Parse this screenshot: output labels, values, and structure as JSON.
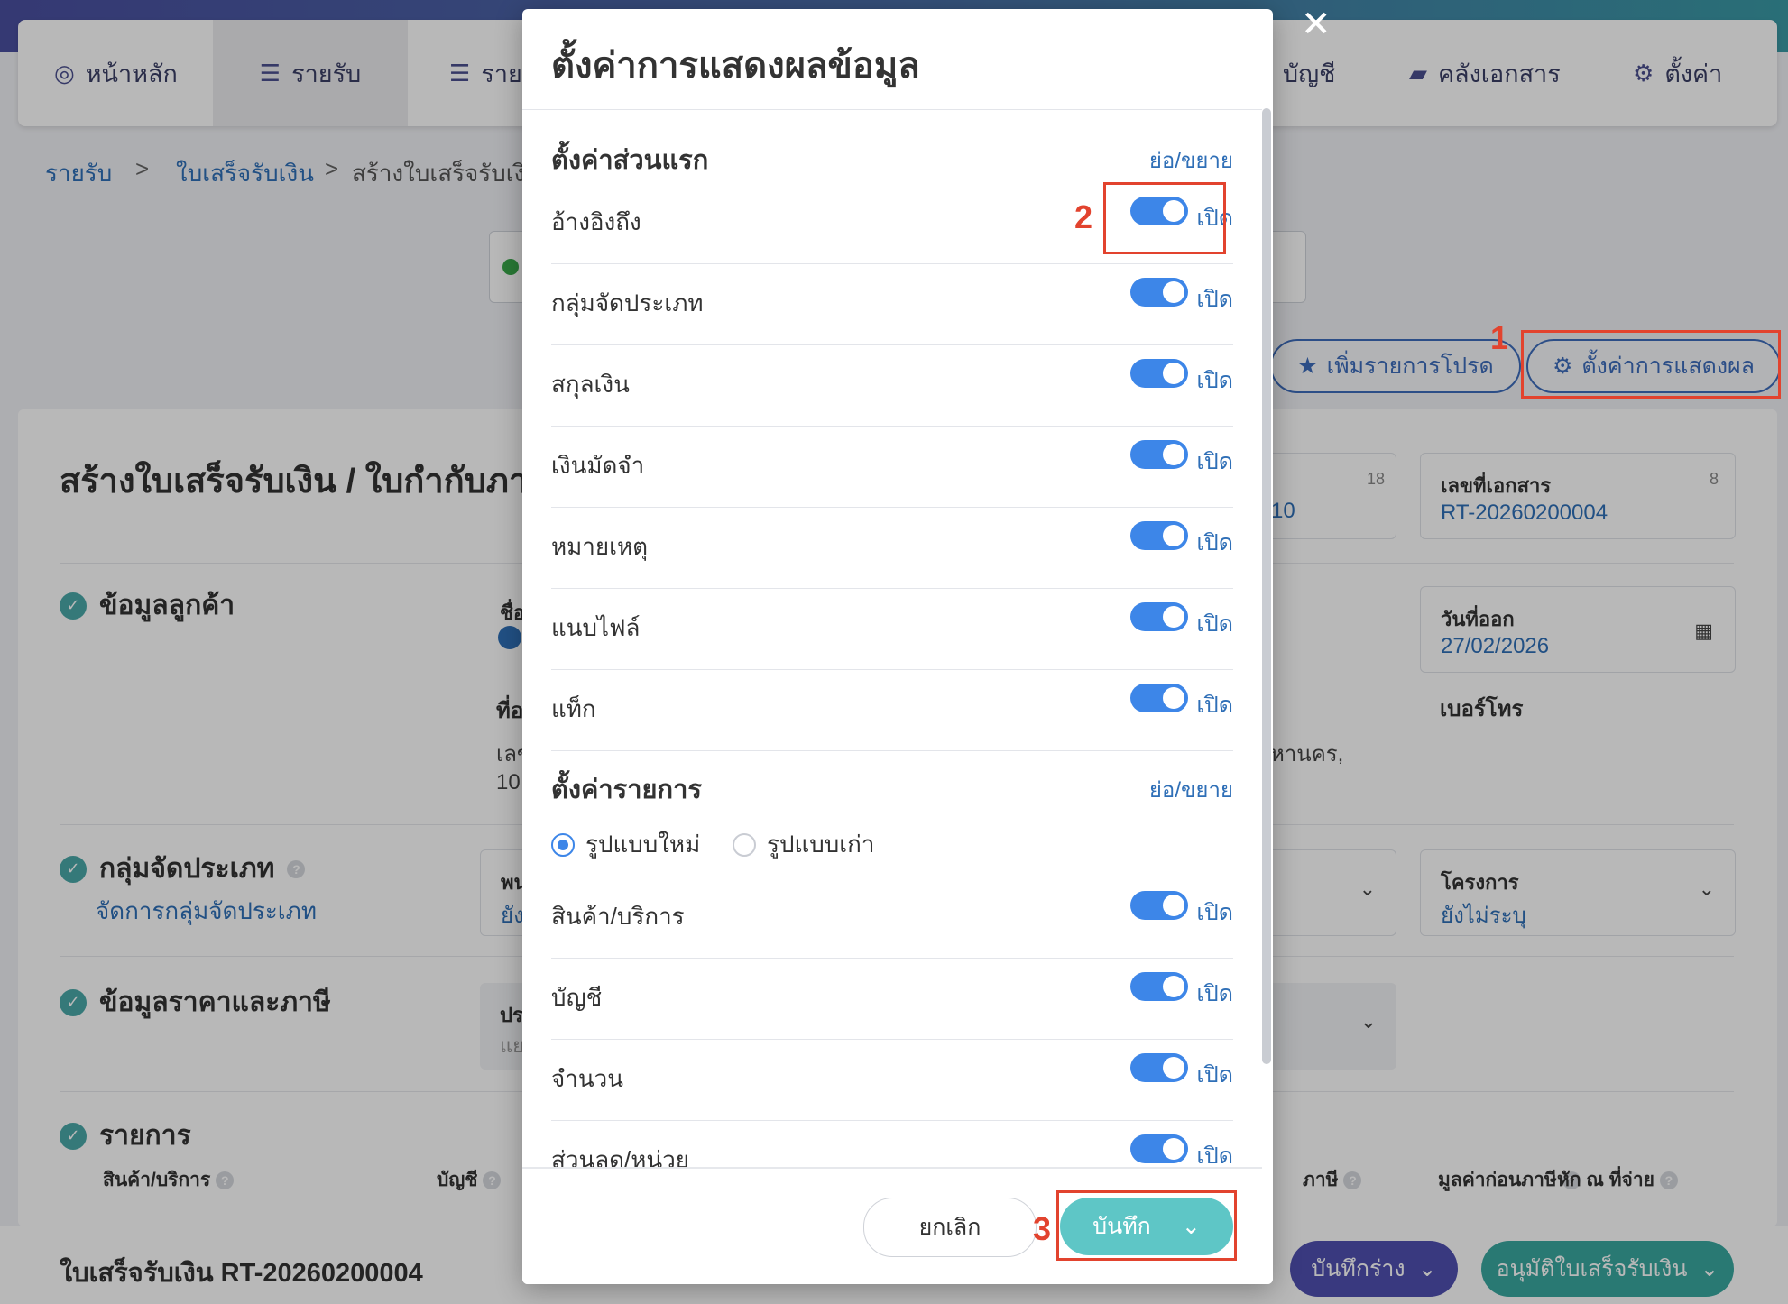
{
  "nav": {
    "items": [
      {
        "label": "หน้าหลัก",
        "icon": "dashboard-icon"
      },
      {
        "label": "รายรับ",
        "icon": "income-list-icon"
      },
      {
        "label": "ราย",
        "icon": "expense-list-icon"
      },
      {
        "label": "บัญชี",
        "icon": "accounting-icon"
      },
      {
        "label": "คลังเอกสาร",
        "icon": "folder-icon"
      },
      {
        "label": "ตั้งค่า",
        "icon": "gear-icon"
      }
    ]
  },
  "breadcrumb": {
    "level1": "รายรับ",
    "level2": "ใบเสร็จรับเงิน",
    "current": "สร้างใบเสร็จรับเงิน",
    "sep": ">"
  },
  "actions": {
    "favorite": "เพิ่มรายการโปรด",
    "display_settings": "ตั้งค่าการแสดงผล"
  },
  "page": {
    "title": "สร้างใบเสร็จรับเงิน / ใบกำกับภาษี",
    "doc_number_label": "เลขที่เอกสาร",
    "doc_number_value": "RT-20260200004",
    "doc_number_count": "8",
    "ref_count": "18",
    "ref_value_partial": "10",
    "issue_date_label": "วันที่ออก",
    "issue_date_value": "27/02/2026",
    "phone_label": "เบอร์โทร",
    "address_partial": "หานคร,",
    "address_partial_left": "เลข",
    "zip_partial": "10",
    "customer_name_partial": "ชื่อ",
    "address_label_partial": "ที่อ",
    "project_label": "โครงการ",
    "project_value": "ยังไม่ระบุ",
    "emp_label_partial": "พน",
    "emp_value_partial": "ยัง",
    "price_label_partial": "ปร",
    "price_value_partial": "แย"
  },
  "sections": {
    "customer": "ข้อมูลลูกค้า",
    "category": "กลุ่มจัดประเภท",
    "category_link": "จัดการกลุ่มจัดประเภท",
    "pricing": "ข้อมูลราคาและภาษี",
    "items": "รายการ"
  },
  "items_table": {
    "headers": [
      "สินค้า/บริการ",
      "บัญชี",
      "ภาษี",
      "มูลค่าก่อนภาษี",
      "หัก ณ ที่จ่าย"
    ]
  },
  "footer": {
    "doc_title": "ใบเสร็จรับเงิน RT-20260200004",
    "draft_button": "บันทึกร่าง",
    "approve_button": "อนุมัติใบเสร็จรับเงิน"
  },
  "modal": {
    "title": "ตั้งค่าการแสดงผลข้อมูล",
    "close_symbol": "✕",
    "section1": {
      "title": "ตั้งค่าส่วนแรก",
      "collapse": "ย่อ/ขยาย",
      "rows": [
        {
          "label": "อ้างอิงถึง",
          "state": "เปิด"
        },
        {
          "label": "กลุ่มจัดประเภท",
          "state": "เปิด"
        },
        {
          "label": "สกุลเงิน",
          "state": "เปิด"
        },
        {
          "label": "เงินมัดจำ",
          "state": "เปิด"
        },
        {
          "label": "หมายเหตุ",
          "state": "เปิด"
        },
        {
          "label": "แนบไฟล์",
          "state": "เปิด"
        },
        {
          "label": "แท็ก",
          "state": "เปิด"
        }
      ]
    },
    "section2": {
      "title": "ตั้งค่ารายการ",
      "collapse": "ย่อ/ขยาย",
      "layout_new": "รูปแบบใหม่",
      "layout_old": "รูปแบบเก่า",
      "rows": [
        {
          "label": "สินค้า/บริการ",
          "state": "เปิด"
        },
        {
          "label": "บัญชี",
          "state": "เปิด"
        },
        {
          "label": "จำนวน",
          "state": "เปิด"
        },
        {
          "label": "ส่วนลด/หน่วย",
          "state": "เปิด"
        }
      ]
    },
    "cancel": "ยกเลิก",
    "save": "บันทึก"
  },
  "annotations": {
    "n1": "1",
    "n2": "2",
    "n3": "3"
  },
  "colors": {
    "accent": "#3d86e8",
    "save": "#5ec6c6",
    "annotation": "#e2432e",
    "draft": "#4f4fb0",
    "approve": "#3aa8a0"
  }
}
